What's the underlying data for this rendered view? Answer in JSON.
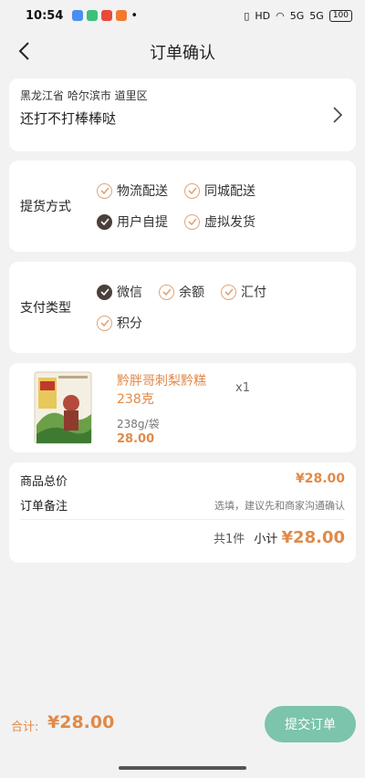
{
  "status": {
    "time": "10:54",
    "dot": "•",
    "network": "HD",
    "signal1": "5G",
    "signal2": "5G",
    "battery": "100"
  },
  "nav": {
    "title": "订单确认"
  },
  "address": {
    "region": "黑龙江省 哈尔滨市 道里区",
    "detail": "还打不打棒棒哒"
  },
  "delivery": {
    "label": "提货方式",
    "options": [
      {
        "label": "物流配送",
        "checked": false
      },
      {
        "label": "同城配送",
        "checked": false
      },
      {
        "label": "用户自提",
        "checked": true
      },
      {
        "label": "虚拟发货",
        "checked": false
      }
    ]
  },
  "payment": {
    "label": "支付类型",
    "options": [
      {
        "label": "微信",
        "checked": true
      },
      {
        "label": "余额",
        "checked": false
      },
      {
        "label": "汇付",
        "checked": false
      },
      {
        "label": "积分",
        "checked": false
      }
    ]
  },
  "product": {
    "name": "黔胖哥刺梨黔糕238克",
    "qty": "x1",
    "spec": "238g/袋",
    "price": "28.00"
  },
  "summary": {
    "total_label": "商品总价",
    "total_value": "¥28.00",
    "remark_label": "订单备注",
    "remark_placeholder": "选填，建议先和商家沟通确认",
    "count_text": "共1件",
    "subtotal_label": "小计",
    "subtotal_value": "¥28.00"
  },
  "bottom": {
    "total_label": "合计:",
    "total_value": "¥28.00",
    "submit_label": "提交订单"
  },
  "colors": {
    "accent": "#e08a4a",
    "checked": "#4b3f3a",
    "button": "#7cc4ab"
  }
}
